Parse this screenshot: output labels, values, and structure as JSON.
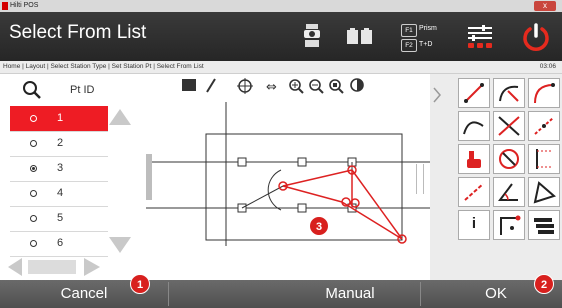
{
  "window": {
    "title": "Hilti POS",
    "close": "x"
  },
  "header": {
    "title": "Select From List",
    "f1_key": "F1",
    "f1_label": "Prism",
    "f2_key": "F2",
    "f2_label": "T+D"
  },
  "breadcrumb": {
    "text": "Home | Layout | Select Station Type | Set Station Pt | Select From List",
    "clock": "03:06"
  },
  "list": {
    "column": "Pt ID",
    "rows": [
      {
        "id": "1",
        "state": "highlighted"
      },
      {
        "id": "2",
        "state": "unselected"
      },
      {
        "id": "3",
        "state": "checked"
      },
      {
        "id": "4",
        "state": "unselected"
      },
      {
        "id": "5",
        "state": "unselected"
      },
      {
        "id": "6",
        "state": "unselected"
      }
    ]
  },
  "right_panel": {
    "info_label": "i"
  },
  "bottom_bar": {
    "cancel": "Cancel",
    "manual": "Manual",
    "ok": "OK"
  },
  "callouts": {
    "cancel": "1",
    "ok": "2",
    "map": "3"
  },
  "colors": {
    "accent": "#ee1c24",
    "header": "#2b2b2b",
    "bottom_bar": "#5b5b5b"
  }
}
